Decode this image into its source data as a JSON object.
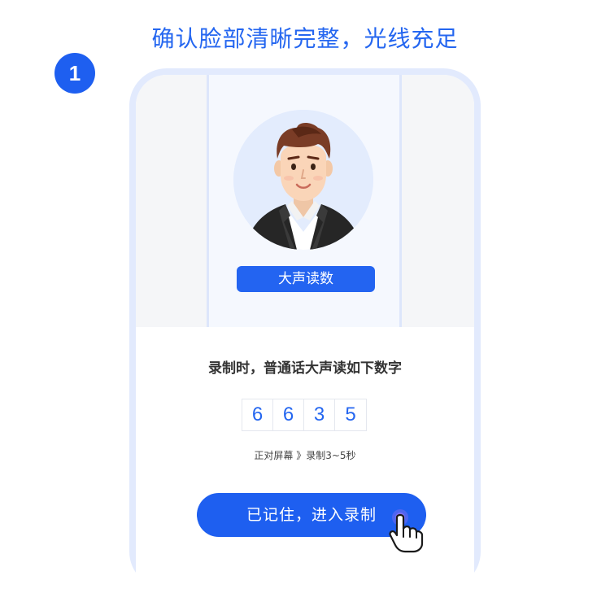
{
  "heading": "确认脸部清晰完整，光线充足",
  "step_number": "1",
  "screen": {
    "read_label": "大声读数",
    "instruction": "录制时，普通话大声读如下数字",
    "digits": [
      "6",
      "6",
      "3",
      "5"
    ],
    "hint": "正对屏幕 》录制3~5秒",
    "cta": "已记住，进入录制"
  },
  "colors": {
    "accent": "#1e5ff0",
    "heading": "#2466f0",
    "frame": "#e2eafd"
  },
  "icons": [
    "avatar-illustration",
    "hand-pointer-icon"
  ]
}
